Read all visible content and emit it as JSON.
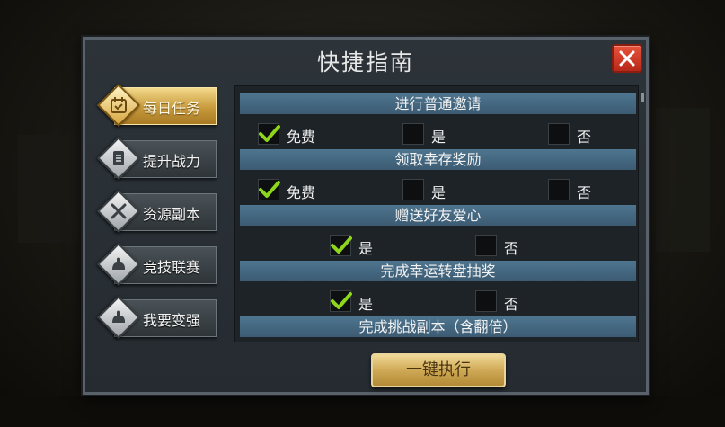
{
  "dialog": {
    "title": "快捷指南",
    "close_icon": "close-icon"
  },
  "sidebar": {
    "items": [
      {
        "label": "每日任务",
        "icon": "calendar-icon",
        "active": true
      },
      {
        "label": "提升战力",
        "icon": "scroll-icon",
        "active": false
      },
      {
        "label": "资源副本",
        "icon": "crossed-swords-icon",
        "active": false
      },
      {
        "label": "竞技联赛",
        "icon": "flexed-arm-icon",
        "active": false
      },
      {
        "label": "我要变强",
        "icon": "flexed-arm-icon",
        "active": false
      }
    ]
  },
  "tasks": [
    {
      "title": "进行普通邀请",
      "options": [
        {
          "label": "免费",
          "checked": true
        },
        {
          "label": "是",
          "checked": false
        },
        {
          "label": "否",
          "checked": false
        }
      ]
    },
    {
      "title": "领取幸存奖励",
      "options": [
        {
          "label": "免费",
          "checked": true
        },
        {
          "label": "是",
          "checked": false
        },
        {
          "label": "否",
          "checked": false
        }
      ]
    },
    {
      "title": "赠送好友爱心",
      "options": [
        {
          "label": "是",
          "checked": true
        },
        {
          "label": "否",
          "checked": false
        }
      ]
    },
    {
      "title": "完成幸运转盘抽奖",
      "options": [
        {
          "label": "是",
          "checked": true
        },
        {
          "label": "否",
          "checked": false
        }
      ]
    },
    {
      "title": "完成挑战副本（含翻倍）",
      "options": []
    }
  ],
  "footer": {
    "execute_label": "一键执行"
  },
  "colors": {
    "accent_gold": "#cfa956",
    "check_green": "#8ed61c",
    "header_blue": "#4f7590",
    "close_red": "#d8402a"
  }
}
